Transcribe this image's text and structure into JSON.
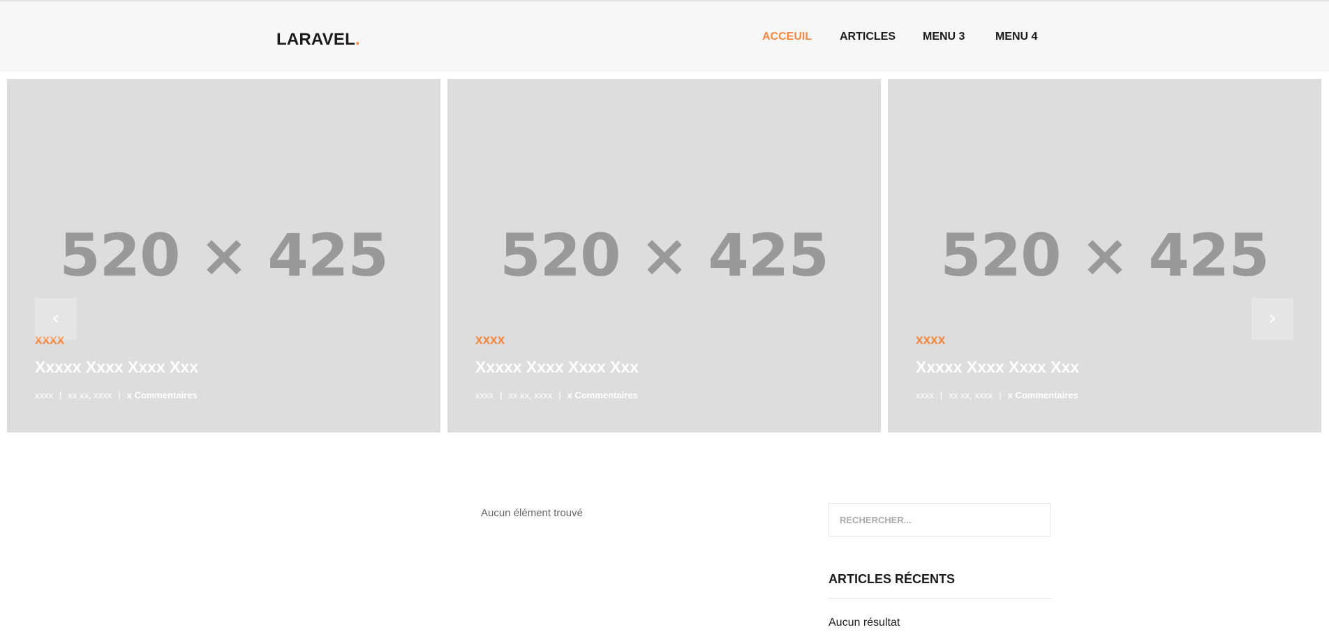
{
  "header": {
    "logo_text": "LARAVEL",
    "logo_dot": ".",
    "nav": [
      {
        "label": "ACCEUIL",
        "active": true
      },
      {
        "label": "ARTICLES",
        "active": false
      },
      {
        "label": "MENU 3",
        "active": false
      },
      {
        "label": "MENU 4",
        "active": false
      }
    ]
  },
  "slider": {
    "prev_label": "‹",
    "next_label": "›",
    "slides": [
      {
        "placeholder": "520 × 425",
        "category": "xxxx",
        "title": "Xxxxx Xxxx Xxxx Xxx",
        "author": "xxxx",
        "sep": "|",
        "date": "xx xx, xxxx",
        "comments": "x Commentaires"
      },
      {
        "placeholder": "520 × 425",
        "category": "xxxx",
        "title": "Xxxxx Xxxx Xxxx Xxx",
        "author": "xxxx",
        "sep": "|",
        "date": "xx xx, xxxx",
        "comments": "x Commentaires"
      },
      {
        "placeholder": "520 × 425",
        "category": "xxxx",
        "title": "Xxxxx Xxxx Xxxx Xxx",
        "author": "xxxx",
        "sep": "|",
        "date": "xx xx, xxxx",
        "comments": "x Commentaires"
      }
    ]
  },
  "main": {
    "empty_message": "Aucun élément trouvé"
  },
  "sidebar": {
    "search_placeholder": "RECHERCHER...",
    "recent_title": "ARTICLES RÉCENTS",
    "recent_empty": "Aucun résultat"
  },
  "colors": {
    "accent": "#f48840",
    "header_bg": "#f7f7f7",
    "placeholder_bg": "#dddddd"
  }
}
